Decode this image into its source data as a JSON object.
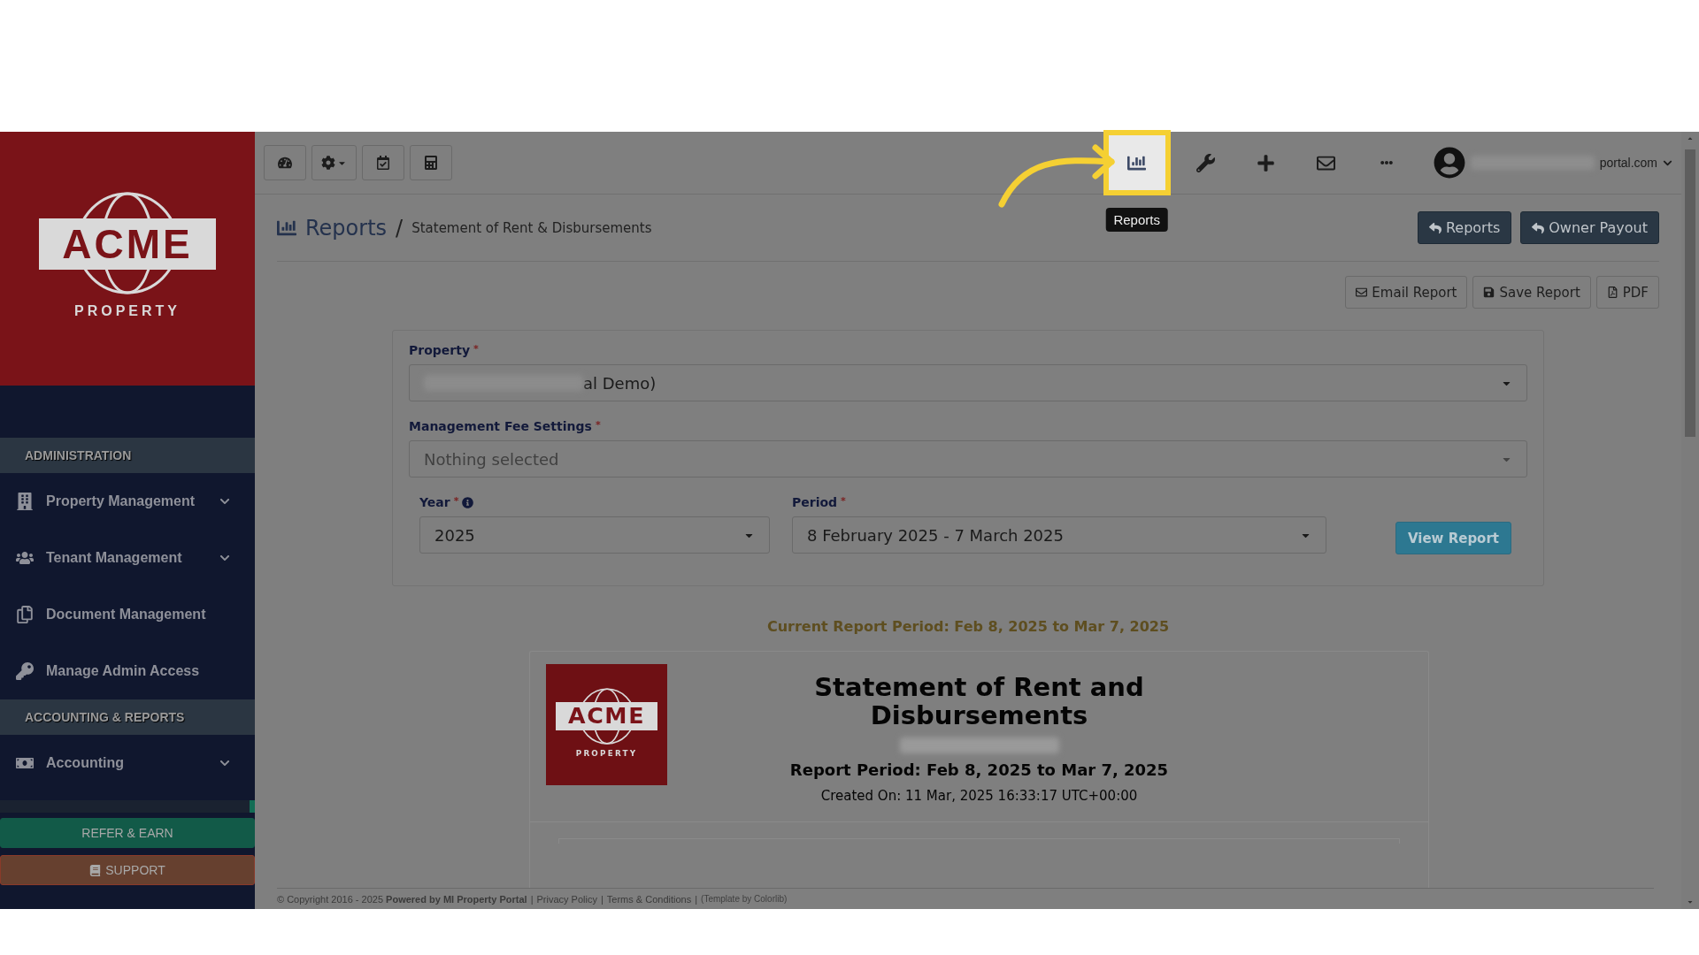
{
  "sidebar": {
    "logo": {
      "wordmark": "ACME",
      "tagline": "PROPERTY"
    },
    "sections": [
      {
        "title": "ADMINISTRATION",
        "items": [
          {
            "label": "Property Management",
            "expandable": true
          },
          {
            "label": "Tenant Management",
            "expandable": true
          },
          {
            "label": "Document Management",
            "expandable": false
          },
          {
            "label": "Manage Admin Access",
            "expandable": false
          }
        ]
      },
      {
        "title": "ACCOUNTING & REPORTS",
        "items": [
          {
            "label": "Accounting",
            "expandable": true
          }
        ]
      }
    ],
    "buttons": [
      {
        "label": "REFER & EARN",
        "kind": "refer"
      },
      {
        "label": "SUPPORT",
        "kind": "support"
      }
    ]
  },
  "toolbar": {
    "left_buttons": [
      {
        "has_caret": false
      },
      {
        "has_caret": true
      },
      {
        "has_caret": false
      },
      {
        "has_caret": false
      }
    ],
    "right_icons": [
      {
        "highlighted": true,
        "tooltip": "Reports"
      },
      {
        "highlighted": false
      },
      {
        "highlighted": false
      },
      {
        "highlighted": false
      },
      {
        "highlighted": false
      }
    ],
    "user": {
      "email": "portal.com"
    }
  },
  "breadcrumb": {
    "title": "Reports",
    "separator": "/",
    "current": "Statement of Rent & Disbursements"
  },
  "header_buttons": [
    "Reports",
    "Owner Payout"
  ],
  "report_actions": [
    "Email Report",
    "Save Report",
    "PDF"
  ],
  "form": {
    "property": {
      "label": "Property",
      "required_mark": "*",
      "value": "al Demo)"
    },
    "fee_settings": {
      "label": "Management Fee Settings",
      "required_mark": "*",
      "placeholder": "Nothing selected"
    },
    "year": {
      "label": "Year",
      "required_mark": "*",
      "value": "2025"
    },
    "period": {
      "label": "Period",
      "required_mark": "*",
      "value": "8 February 2025 - 7 March 2025"
    },
    "submit": "View Report"
  },
  "current_period": "Current Report Period: Feb 8, 2025 to Mar 7, 2025",
  "report": {
    "logo": {
      "wordmark": "ACME",
      "tagline": "PROPERTY"
    },
    "title": "Statement of Rent and Disbursements",
    "period": "Report Period: Feb 8, 2025 to Mar 7, 2025",
    "created": "Created On: 11 Mar, 2025 16:33:17 UTC+00:00"
  },
  "footer": {
    "copyright": "© Copyright 2016 - 2025 **Powered by MI Property Portal**",
    "separator": "|",
    "links": [
      "Privacy Policy",
      "Terms & Conditions"
    ],
    "credit": "(Template by Colorlib)"
  }
}
